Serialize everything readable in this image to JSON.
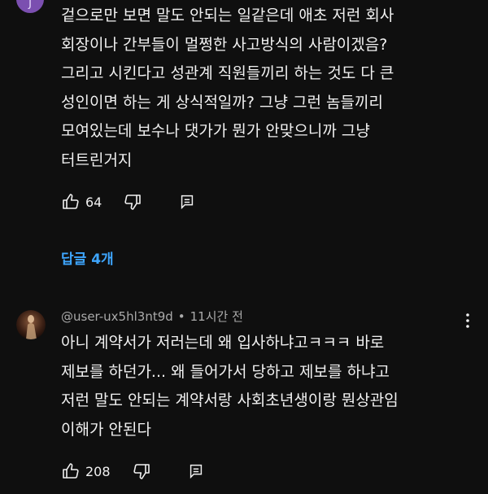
{
  "comment1": {
    "avatar_letter": "J",
    "text": "겉으로만 보면 말도 안되는 일같은데 애초 저런 회사\n회장이나 간부들이 멀쩡한 사고방식의 사람이겠음?\n그리고 시킨다고 성관계 직원들끼리 하는 것도 다 큰\n성인이면 하는 게 상식적일까? 그냥 그런 놈들끼리\n모여있는데 보수나 댓가가 뭔가 안맞으니까 그냥\n터트린거지",
    "like_count": "64",
    "replies_label": "답글 4개"
  },
  "comment2": {
    "author": "@user-ux5hl3nt9d",
    "separator": "•",
    "time": "11시간 전",
    "text": "아니 계약서가 저러는데 왜 입사하냐고ㅋㅋㅋ 바로\n제보를 하던가... 왜 들어가서 당하고 제보를 하냐고\n저런 말도 안되는 계약서랑 사회초년생이랑 뭔상관임\n이해가 안된다",
    "like_count": "208"
  },
  "icons": [
    "like-icon",
    "dislike-icon",
    "reply-icon",
    "more-vert-icon",
    "avatar"
  ],
  "colors": {
    "background": "#0f0f0f",
    "text": "#f1f1f1",
    "meta": "#aaaaaa",
    "link": "#3ea6ff"
  }
}
